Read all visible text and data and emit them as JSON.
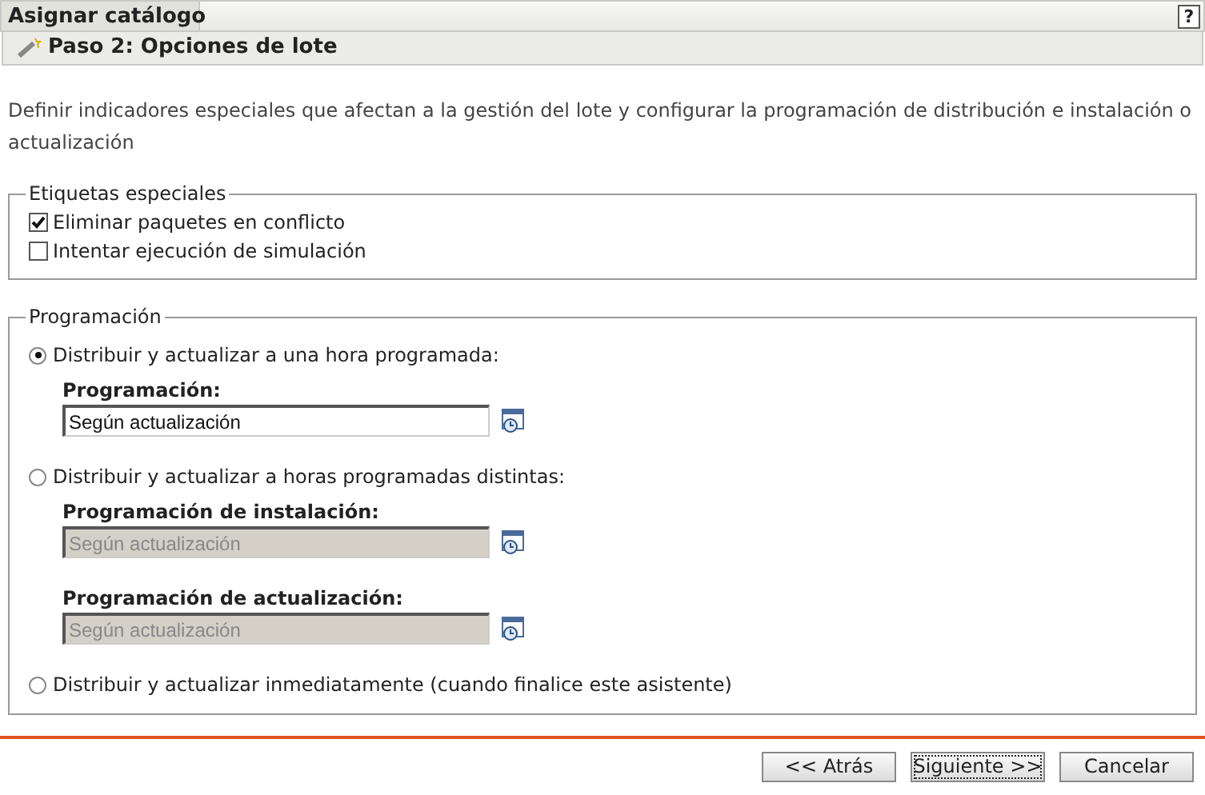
{
  "window": {
    "title": "Asignar catálogo",
    "help": "?"
  },
  "step": {
    "title": "Paso 2: Opciones de lote"
  },
  "description": "Definir indicadores especiales que afectan a la gestión del lote y configurar la programación de distribución e instalación o actualización",
  "special_flags": {
    "legend": "Etiquetas especiales",
    "options": [
      {
        "label": "Eliminar paquetes en conflicto",
        "checked": true
      },
      {
        "label": "Intentar ejecución de simulación",
        "checked": false
      }
    ]
  },
  "schedule": {
    "legend": "Programación",
    "options": [
      {
        "label": "Distribuir y actualizar a una hora programada:",
        "selected": true,
        "fields": [
          {
            "label": "Programación:",
            "value": "Según actualización",
            "disabled": false
          }
        ]
      },
      {
        "label": "Distribuir y actualizar a horas programadas distintas:",
        "selected": false,
        "fields": [
          {
            "label": "Programación de instalación:",
            "value": "Según actualización",
            "disabled": true
          },
          {
            "label": "Programación de actualización:",
            "value": "Según actualización",
            "disabled": true
          }
        ]
      },
      {
        "label": "Distribuir y actualizar inmediatamente (cuando finalice este asistente)",
        "selected": false
      }
    ]
  },
  "buttons": [
    {
      "label": "<< Atrás",
      "focused": false
    },
    {
      "label": "Siguiente >>",
      "focused": true
    },
    {
      "label": "Cancelar",
      "focused": false
    }
  ]
}
